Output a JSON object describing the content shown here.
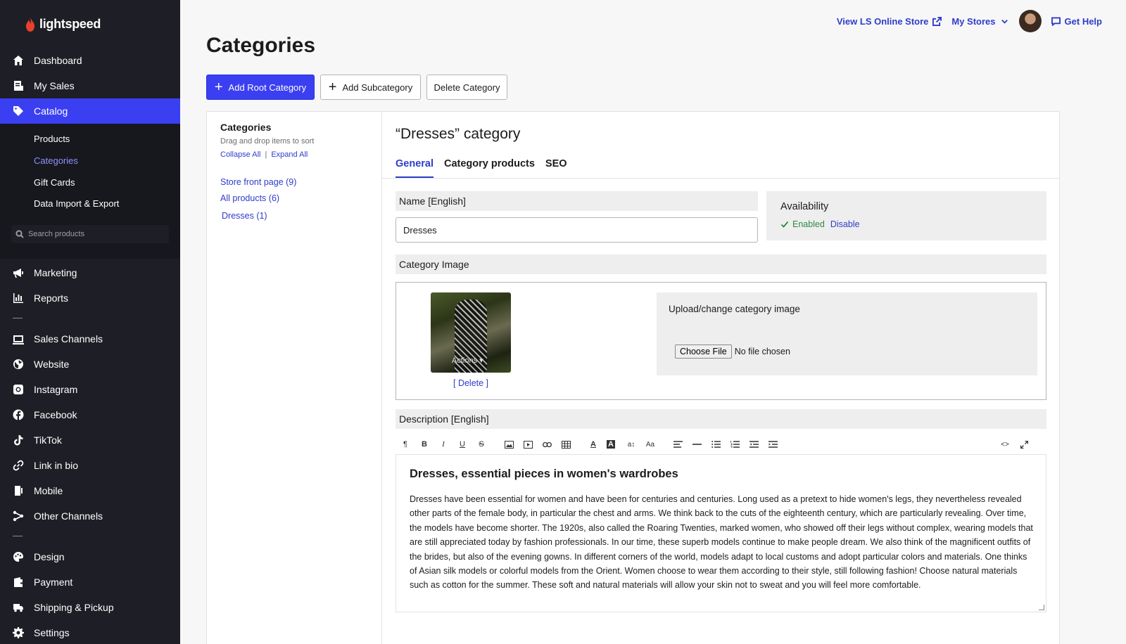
{
  "brand": {
    "name": "lightspeed"
  },
  "nav": {
    "dashboard": "Dashboard",
    "my_sales": "My Sales",
    "catalog": "Catalog",
    "marketing": "Marketing",
    "reports": "Reports",
    "sales_channels": "Sales Channels",
    "website": "Website",
    "instagram": "Instagram",
    "facebook": "Facebook",
    "tiktok": "TikTok",
    "link_in_bio": "Link in bio",
    "mobile": "Mobile",
    "other_channels": "Other Channels",
    "design": "Design",
    "payment": "Payment",
    "shipping": "Shipping & Pickup",
    "settings": "Settings"
  },
  "subnav": {
    "products": "Products",
    "categories": "Categories",
    "gift_cards": "Gift Cards",
    "data_import": "Data Import & Export",
    "search_placeholder": "Search products"
  },
  "topbar": {
    "view_store": "View LS Online Store",
    "my_stores": "My Stores",
    "get_help": "Get Help"
  },
  "page": {
    "title": "Categories",
    "add_root": "Add Root Category",
    "add_sub": "Add Subcategory",
    "delete": "Delete Category"
  },
  "tree": {
    "title": "Categories",
    "hint": "Drag and drop items to sort",
    "collapse": "Collapse All",
    "divider": "|",
    "expand": "Expand All",
    "nodes": [
      "Store front page (9)",
      "All products (6)",
      "Dresses (1)"
    ]
  },
  "detail": {
    "heading": "“Dresses” category",
    "tabs": [
      "General",
      "Category products",
      "SEO"
    ],
    "name_label": "Name [English]",
    "name_value": "Dresses",
    "availability": "Availability",
    "enabled": "Enabled",
    "disable": "Disable",
    "image_label": "Category Image",
    "actions": "Actions",
    "delete_image": "[ Delete ]",
    "upload_title": "Upload/change category image",
    "choose_file": "Choose File",
    "no_file": "No file chosen",
    "description_label": "Description [English]",
    "desc_heading": "Dresses, essential pieces in women's wardrobes",
    "desc_body": "Dresses have been essential for women and have been for centuries and centuries. Long used as a pretext to hide women's legs, they nevertheless revealed other parts of the female body, in particular the chest and arms. We think back to the cuts of the eighteenth century, which are particularly revealing. Over time, the models have become shorter. The 1920s, also called the Roaring Twenties, marked women, who showed off their legs without complex, wearing models that are still appreciated today by fashion professionals. In our time, these superb models continue to make people dream. We also think of the magnificent outfits of the brides, but also of the evening gowns. In different corners of the world, models adapt to local customs and adopt particular colors and materials. One thinks of Asian silk models or colorful models from the Orient. Women choose to wear them according to their style, still following fashion! Choose natural materials such as cotton for the summer. These soft and natural materials will allow your skin not to sweat and you will feel more comfortable."
  },
  "colors": {
    "accent": "#3b3ff2",
    "link": "#2f3bcb",
    "sidebar": "#1e1f26",
    "enabled": "#2d8a3e"
  }
}
